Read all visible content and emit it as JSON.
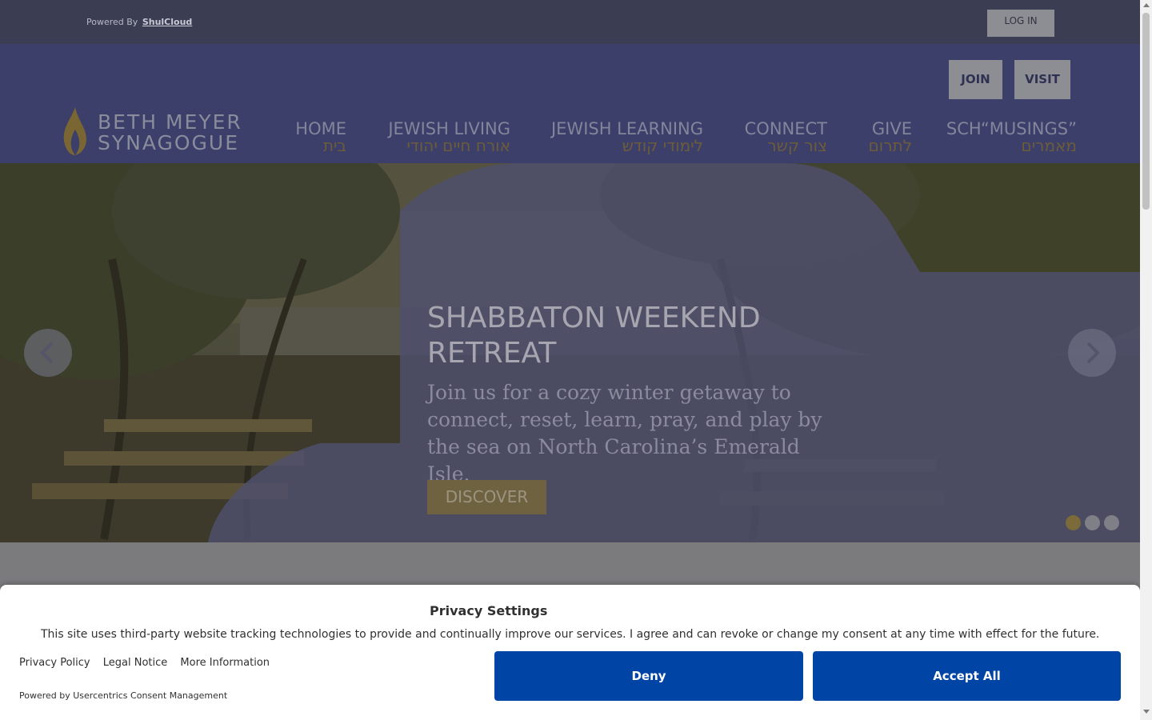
{
  "topbar": {
    "powered_prefix": "Powered By",
    "powered_link": "ShulCloud",
    "login_label": "LOG IN"
  },
  "header": {
    "join_label": "JOIN",
    "visit_label": "VISIT",
    "logo_line1": "BETH MEYER",
    "logo_line2": "SYNAGOGUE",
    "nav": [
      {
        "en": "HOME",
        "he": "בית"
      },
      {
        "en": "JEWISH LIVING",
        "he": "אורח חיים יהודי"
      },
      {
        "en": "JEWISH LEARNING",
        "he": "לימודי קודש"
      },
      {
        "en": "CONNECT",
        "he": "צור קשר"
      },
      {
        "en": "GIVE",
        "he": "לתרום"
      },
      {
        "en": "SCH“MUSINGS”",
        "he": "מאמרים"
      }
    ]
  },
  "hero": {
    "title": "SHABBATON WEEKEND RETREAT",
    "text": "Join us for a cozy winter getaway to connect, reset, learn, pray, and play by the sea on North Carolina’s Emerald Isle.",
    "cta_label": "DISCOVER",
    "slide_count": 3,
    "active_slide": 1
  },
  "consent": {
    "title": "Privacy Settings",
    "text": "This site uses third-party website tracking technologies to provide and continually improve our services. I agree and can revoke or change my consent at any time with effect for the future.",
    "links": [
      "Privacy Policy",
      "Legal Notice",
      "More Information"
    ],
    "powered": "Powered by Usercentrics Consent Management",
    "deny_label": "Deny",
    "accept_label": "Accept All"
  },
  "colors": {
    "header_bg": "#3c3f6a",
    "accent_gold": "#7b6a3a",
    "consent_button": "#0045a5"
  }
}
